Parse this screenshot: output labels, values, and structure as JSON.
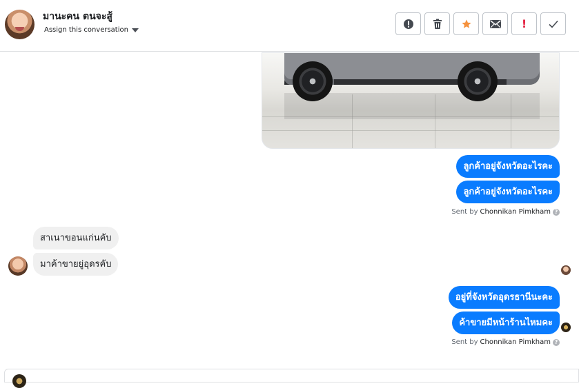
{
  "header": {
    "contact_name": "มานะคน ตนจะสู้",
    "assign_label": "Assign this conversation",
    "tools": [
      {
        "name": "spam-icon",
        "glyph": "●!",
        "color": "#444950"
      },
      {
        "name": "trash-icon",
        "glyph": "🗑",
        "color": "#444950"
      },
      {
        "name": "star-icon",
        "glyph": "★",
        "color": "#f5923e"
      },
      {
        "name": "envelope-icon",
        "glyph": "✉",
        "color": "#444950"
      },
      {
        "name": "follow-up-icon",
        "glyph": "!",
        "color": "#e41e3f"
      },
      {
        "name": "check-icon",
        "glyph": "✓",
        "color": "#444950"
      }
    ]
  },
  "messages": {
    "out_group_1": [
      "ลูกค้าอยู่จังหวัดอะไรคะ",
      "ลูกค้าอยู่จังหวัดอะไรคะ"
    ],
    "sent_by_1": {
      "prefix": "Sent by",
      "name": "Chonnikan Pimkham",
      "help": "?"
    },
    "in_group": [
      "สาเนาขอนแก่นคับ",
      "มาค้าขายยู่อุดรคับ"
    ],
    "out_group_2": [
      "อยู่ที่จังหวัดอุดรธานีนะคะ",
      "ค้าขายมีหน้าร้านไหมคะ"
    ],
    "sent_by_2": {
      "prefix": "Sent by",
      "name": "Chonnikan Pimkham",
      "help": "?"
    }
  },
  "colors": {
    "outgoing_bubble": "#0a7cff",
    "incoming_bubble": "#f0f0f0"
  }
}
